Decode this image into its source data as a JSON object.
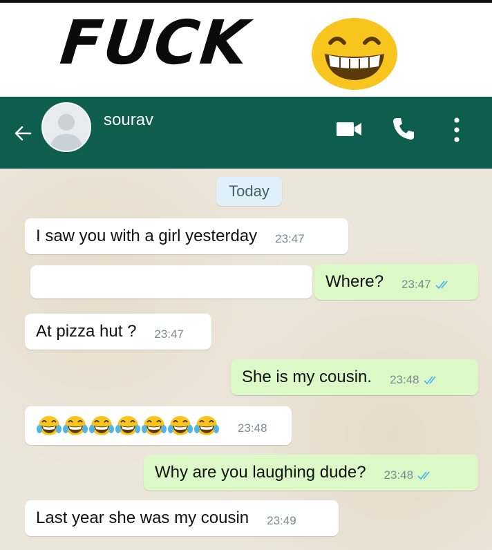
{
  "caption": {
    "text": "FUCK",
    "emoji": "laughing-emoji"
  },
  "header": {
    "contact_name": "sourav",
    "icons": [
      "back-arrow-icon",
      "avatar",
      "video-call-icon",
      "phone-icon",
      "more-menu-icon"
    ]
  },
  "chat": {
    "date_label": "Today",
    "messages": [
      {
        "direction": "in",
        "text": "I saw you with a girl yesterday",
        "time": "23:47"
      },
      {
        "direction": "in",
        "text": "",
        "time": ""
      },
      {
        "direction": "out",
        "text": "Where?",
        "time": "23:47",
        "status": "read"
      },
      {
        "direction": "in",
        "text": "At pizza hut ?",
        "time": "23:47"
      },
      {
        "direction": "out",
        "text": "She is my cousin.",
        "time": "23:48",
        "status": "read"
      },
      {
        "direction": "in",
        "text": "",
        "emoji_count": 7,
        "emoji": "tears-of-joy-emoji",
        "time": "23:48"
      },
      {
        "direction": "out",
        "text": "Why are you laughing dude?",
        "time": "23:48",
        "status": "read"
      },
      {
        "direction": "in",
        "text": "Last year she was my cousin",
        "time": "23:49"
      }
    ]
  },
  "colors": {
    "appbar": "#0d5e4f",
    "incoming_bubble": "#ffffff",
    "outgoing_bubble": "#dcf8c6",
    "read_ticks": "#4fb6ec",
    "chat_background": "#ece5da"
  }
}
